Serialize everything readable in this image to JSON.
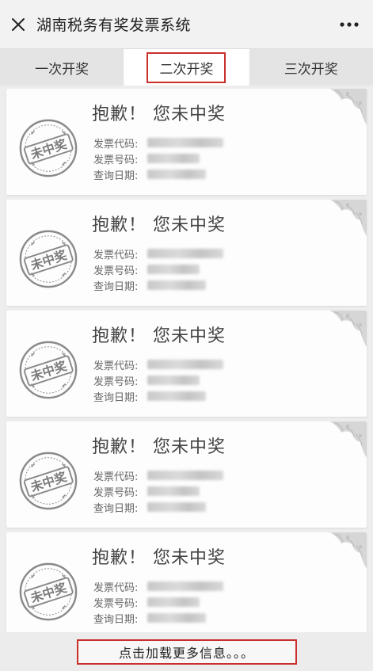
{
  "header": {
    "title": "湖南税务有奖发票系统",
    "close_icon": "close-icon",
    "more_icon": "more-dots-icon"
  },
  "tabs": [
    {
      "label": "一次开奖",
      "active": false
    },
    {
      "label": "二次开奖",
      "active": true
    },
    {
      "label": "三次开奖",
      "active": false
    }
  ],
  "results": [
    {
      "title": "抱歉！ 您未中奖",
      "stamp_text": "未中奖",
      "fields": [
        {
          "label": "发票代码:"
        },
        {
          "label": "发票号码:"
        },
        {
          "label": "查询日期:"
        }
      ]
    },
    {
      "title": "抱歉！ 您未中奖",
      "stamp_text": "未中奖",
      "fields": [
        {
          "label": "发票代码:"
        },
        {
          "label": "发票号码:"
        },
        {
          "label": "查询日期:"
        }
      ]
    },
    {
      "title": "抱歉！ 您未中奖",
      "stamp_text": "未中奖",
      "fields": [
        {
          "label": "发票代码:"
        },
        {
          "label": "发票号码:"
        },
        {
          "label": "查询日期:"
        }
      ]
    },
    {
      "title": "抱歉！ 您未中奖",
      "stamp_text": "未中奖",
      "fields": [
        {
          "label": "发票代码:"
        },
        {
          "label": "发票号码:"
        },
        {
          "label": "查询日期:"
        }
      ]
    },
    {
      "title": "抱歉！ 您未中奖",
      "stamp_text": "未中奖",
      "fields": [
        {
          "label": "发票代码:"
        },
        {
          "label": "发票号码:"
        },
        {
          "label": "查询日期:"
        }
      ]
    }
  ],
  "footer": {
    "load_more_label": "点击加载更多信息。。。"
  },
  "colors": {
    "highlight_border": "#c9302c",
    "stamp": "#8a8a8a"
  }
}
